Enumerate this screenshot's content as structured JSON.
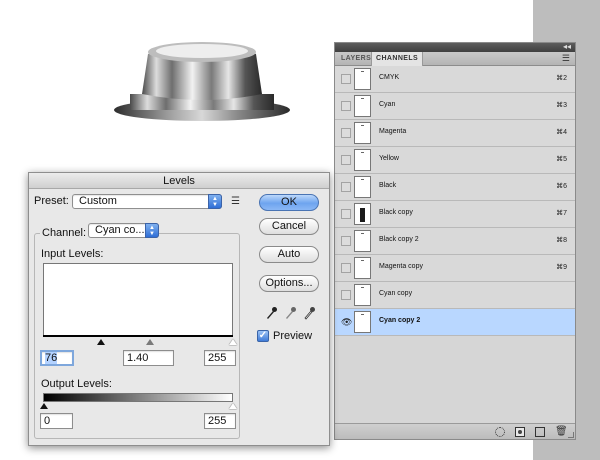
{
  "levels_dialog": {
    "title": "Levels",
    "preset_label": "Preset:",
    "preset_value": "Custom",
    "channel_label": "Channel:",
    "channel_value": "Cyan co...",
    "input_levels_label": "Input Levels:",
    "input_black": "76",
    "input_gamma": "1.40",
    "input_white": "255",
    "output_levels_label": "Output Levels:",
    "output_black": "0",
    "output_white": "255",
    "buttons": {
      "ok": "OK",
      "cancel": "Cancel",
      "auto": "Auto",
      "options": "Options..."
    },
    "preview_label": "Preview",
    "preview_checked": true
  },
  "channels_panel": {
    "tabs": [
      "LAYERS",
      "CHANNELS"
    ],
    "active_tab": "CHANNELS",
    "rows": [
      {
        "label": "CMYK",
        "shortcut": "⌘2",
        "visible": false,
        "selected": false
      },
      {
        "label": "Cyan",
        "shortcut": "⌘3",
        "visible": false,
        "selected": false
      },
      {
        "label": "Magenta",
        "shortcut": "⌘4",
        "visible": false,
        "selected": false
      },
      {
        "label": "Yellow",
        "shortcut": "⌘5",
        "visible": false,
        "selected": false
      },
      {
        "label": "Black",
        "shortcut": "⌘6",
        "visible": false,
        "selected": false
      },
      {
        "label": "Black copy",
        "shortcut": "⌘7",
        "visible": false,
        "selected": false
      },
      {
        "label": "Black copy 2",
        "shortcut": "⌘8",
        "visible": false,
        "selected": false
      },
      {
        "label": "Magenta copy",
        "shortcut": "⌘9",
        "visible": false,
        "selected": false
      },
      {
        "label": "Cyan copy",
        "shortcut": "",
        "visible": false,
        "selected": false
      },
      {
        "label": "Cyan copy 2",
        "shortcut": "",
        "visible": true,
        "selected": true
      }
    ],
    "colors": {
      "selected_row": "#b9d7ff",
      "panel_bg": "#d6d6d6"
    }
  },
  "colors": {
    "accent_blue": "#6ea4ef",
    "canvas_gutter": "#bdbdbd"
  }
}
